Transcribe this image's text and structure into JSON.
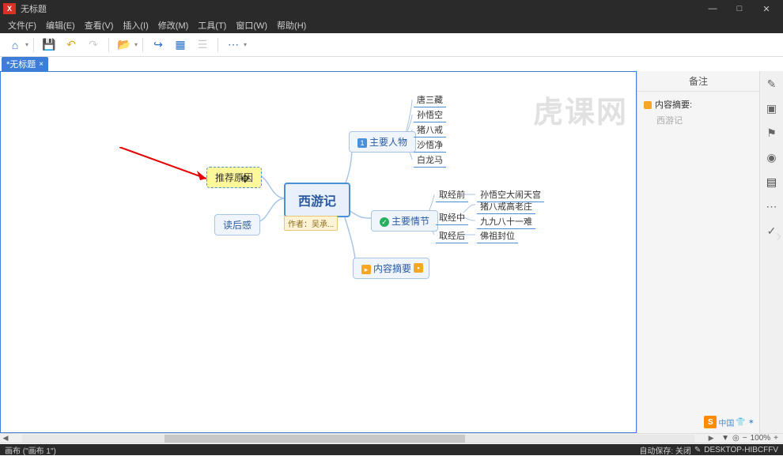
{
  "window": {
    "title": "无标题",
    "buttons": {
      "min": "—",
      "max": "□",
      "close": "✕"
    }
  },
  "menu": {
    "items": [
      "文件(F)",
      "编辑(E)",
      "查看(V)",
      "插入(I)",
      "修改(M)",
      "工具(T)",
      "窗口(W)",
      "帮助(H)"
    ]
  },
  "tabs": {
    "active": "*无标题"
  },
  "watermark": "虎课网",
  "notes_panel": {
    "header": "备注",
    "note_title": "内容摘要:",
    "note_text": "西游记"
  },
  "mindmap": {
    "root": "西游记",
    "author_label": "作者：吴承...",
    "branches": {
      "recommend": "推荐原因",
      "review": "读后感",
      "characters": {
        "label": "主要人物",
        "items": [
          "唐三藏",
          "孙悟空",
          "猪八戒",
          "沙悟净",
          "白龙马"
        ]
      },
      "plot": {
        "label": "主要情节",
        "phases": [
          {
            "phase": "取经前",
            "event": "孙悟空大闹天宫"
          },
          {
            "phase": "取经中",
            "events": [
              "猪八戒高老庄",
              "九九八十一难"
            ]
          },
          {
            "phase": "取经后",
            "event": "佛祖封位"
          }
        ]
      },
      "summary": "内容摘要"
    }
  },
  "sheets": {
    "active": "画布 1"
  },
  "zoom": {
    "label": "100%"
  },
  "status": {
    "left": "画布 (\"画布 1\")",
    "autosave": "自动保存: 关闭",
    "host": "DESKTOP-HIBCFFV"
  },
  "ime": {
    "brand": "中国"
  }
}
